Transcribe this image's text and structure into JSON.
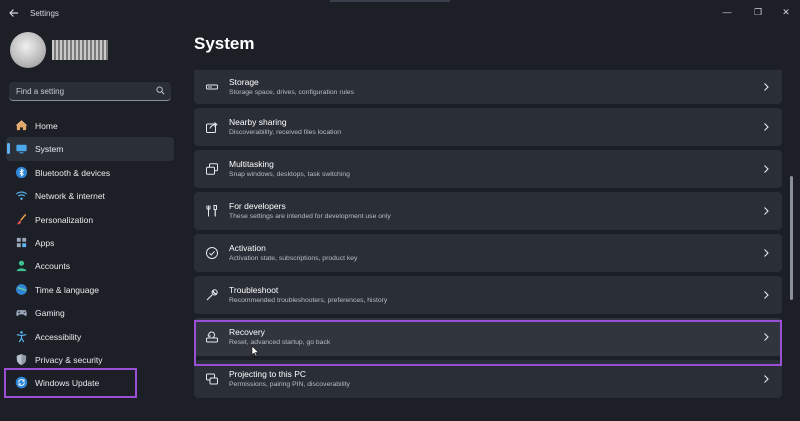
{
  "window": {
    "title": "Settings",
    "controls": {
      "minimize": "—",
      "maximize": "❐",
      "close": "✕"
    }
  },
  "search": {
    "placeholder": "Find a setting"
  },
  "sidebar": {
    "items": [
      {
        "label": "Home",
        "icon": "home-icon"
      },
      {
        "label": "System",
        "icon": "system-icon",
        "active": true
      },
      {
        "label": "Bluetooth & devices",
        "icon": "bluetooth-icon"
      },
      {
        "label": "Network & internet",
        "icon": "wifi-icon"
      },
      {
        "label": "Personalization",
        "icon": "brush-icon"
      },
      {
        "label": "Apps",
        "icon": "apps-icon"
      },
      {
        "label": "Accounts",
        "icon": "accounts-icon"
      },
      {
        "label": "Time & language",
        "icon": "globe-icon"
      },
      {
        "label": "Gaming",
        "icon": "gamepad-icon"
      },
      {
        "label": "Accessibility",
        "icon": "accessibility-icon"
      },
      {
        "label": "Privacy & security",
        "icon": "shield-icon"
      },
      {
        "label": "Windows Update",
        "icon": "update-icon"
      }
    ]
  },
  "main": {
    "title": "System",
    "items": [
      {
        "title": "Storage",
        "subtitle": "Storage space, drives, configuration rules",
        "icon": "storage-icon"
      },
      {
        "title": "Nearby sharing",
        "subtitle": "Discoverability, received files location",
        "icon": "share-icon"
      },
      {
        "title": "Multitasking",
        "subtitle": "Snap windows, desktops, task switching",
        "icon": "multitasking-icon"
      },
      {
        "title": "For developers",
        "subtitle": "These settings are intended for development use only",
        "icon": "developer-tools-icon"
      },
      {
        "title": "Activation",
        "subtitle": "Activation state, subscriptions, product key",
        "icon": "activation-check-icon"
      },
      {
        "title": "Troubleshoot",
        "subtitle": "Recommended troubleshooters, preferences, history",
        "icon": "wrench-icon"
      },
      {
        "title": "Recovery",
        "subtitle": "Reset, advanced startup, go back",
        "icon": "recovery-icon"
      },
      {
        "title": "Projecting to this PC",
        "subtitle": "Permissions, pairing PIN, discoverability",
        "icon": "projecting-icon"
      }
    ]
  },
  "colors": {
    "background": "#1c1f26",
    "card": "#2a2e36",
    "accent": "#5fb2f2",
    "highlight_box": "#9b4fd6"
  }
}
